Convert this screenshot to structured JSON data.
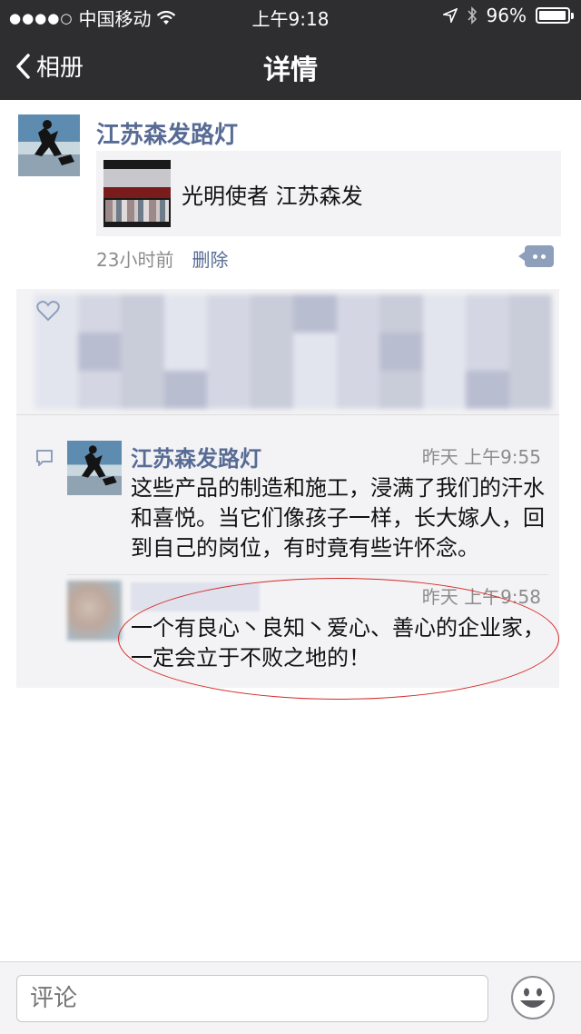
{
  "status_bar": {
    "carrier": "中国移动",
    "time": "上午9:18",
    "battery": "96%",
    "battery_level": 0.96
  },
  "nav": {
    "back_label": "相册",
    "title": "详情"
  },
  "post": {
    "author": "江苏森发路灯",
    "link_title": "光明使者 江苏森发",
    "time_ago": "23小时前",
    "delete_label": "删除"
  },
  "comments": [
    {
      "author": "江苏森发路灯",
      "time": "昨天 上午9:55",
      "text": "这些产品的制造和施工，浸满了我们的汗水和喜悦。当它们像孩子一样，长大嫁人，回到自己的岗位，有时竟有些许怀念。"
    },
    {
      "author": "",
      "time": "昨天 上午9:58",
      "text": "一个有良心丶良知丶爱心、善心的企业家，一定会立于不败之地的！"
    }
  ],
  "input": {
    "placeholder": "评论"
  },
  "colors": {
    "nav_bg": "#2e2e31",
    "link_blue": "#576b95",
    "highlight_red": "#d42a2a"
  },
  "icons": [
    "back-chevron-icon",
    "wifi-icon",
    "location-icon",
    "bluetooth-icon",
    "heart-icon",
    "comment-icon",
    "emoji-icon"
  ]
}
